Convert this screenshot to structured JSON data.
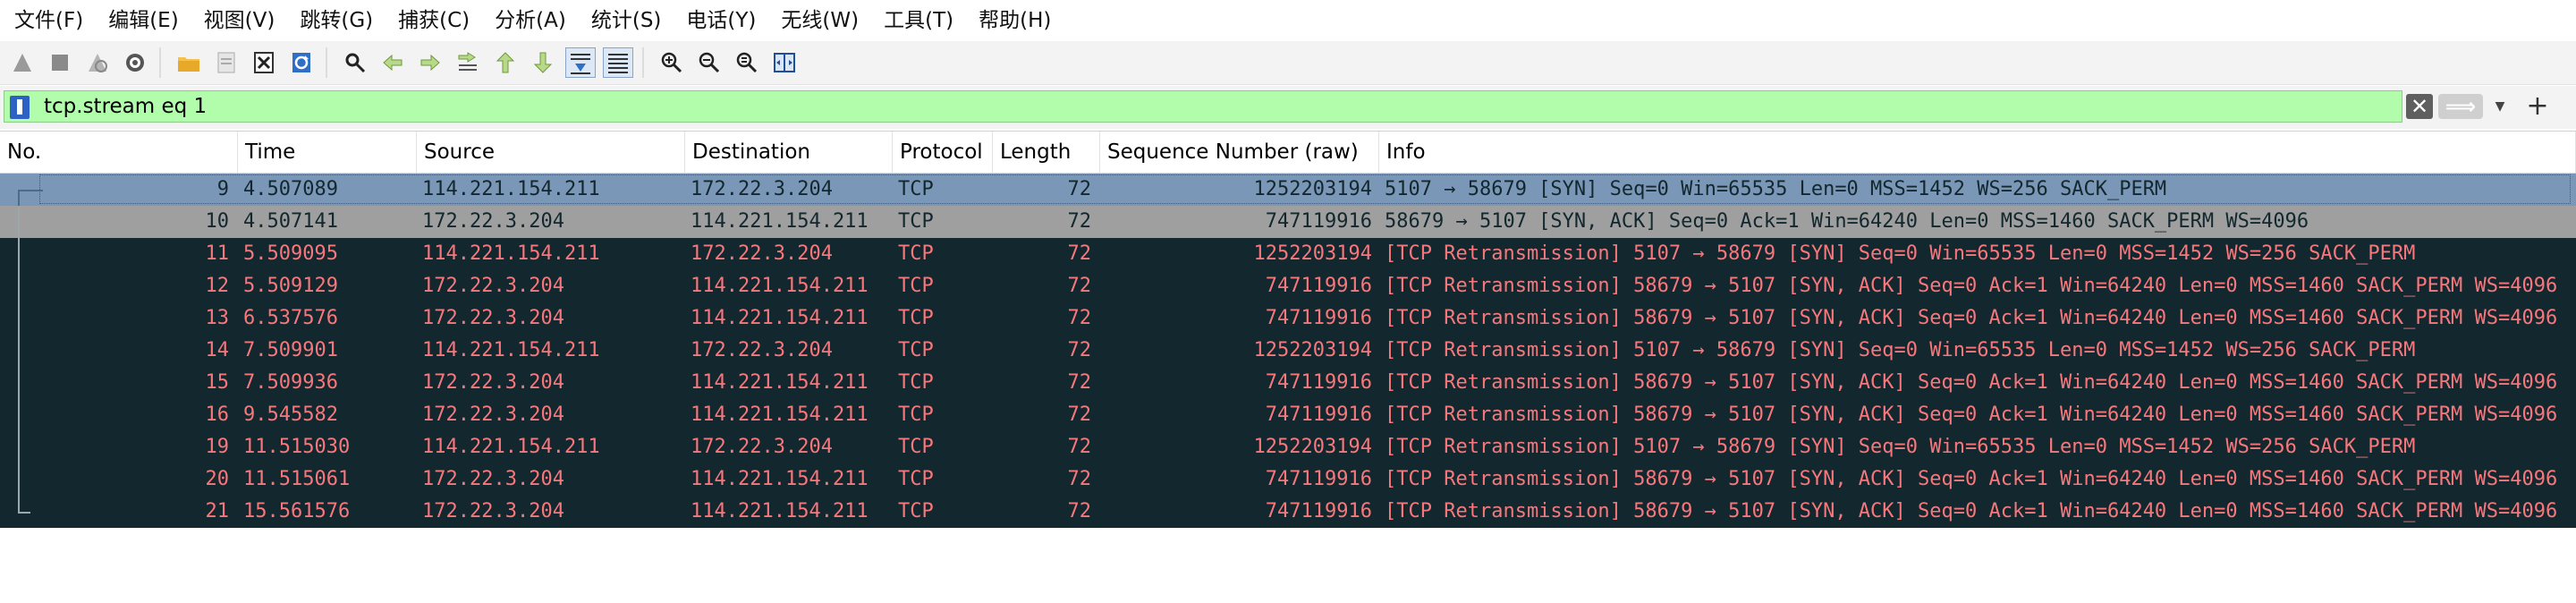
{
  "menu": [
    "文件(F)",
    "编辑(E)",
    "视图(V)",
    "跳转(G)",
    "捕获(C)",
    "分析(A)",
    "统计(S)",
    "电话(Y)",
    "无线(W)",
    "工具(T)",
    "帮助(H)"
  ],
  "toolbar": {
    "buttons": [
      "start-capture",
      "stop-capture",
      "restart-capture",
      "capture-options",
      "open-file",
      "save-file",
      "close-file",
      "reload-file",
      "find-packet",
      "go-back",
      "go-forward",
      "go-to-packet",
      "go-first",
      "go-last",
      "autoscroll",
      "colorize",
      "zoom-in",
      "zoom-out",
      "zoom-normal",
      "resize-columns"
    ]
  },
  "filter": {
    "text": "tcp.stream eq 1",
    "clear_glyph": "✕",
    "apply_glyph": "⟹",
    "dropdown_glyph": "▼",
    "add_glyph": "+"
  },
  "columns": [
    "No.",
    "Time",
    "Source",
    "Destination",
    "Protocol",
    "Length",
    "Sequence Number (raw)",
    "Info"
  ],
  "colors": {
    "selected_bg": "#7b97b8",
    "normal_bg": "#9f9f9f",
    "retrans_bg": "#12272e",
    "retrans_fg": "#f7787c",
    "normal_fg": "#12272e",
    "filter_bg": "#b1fdac"
  },
  "packets": [
    {
      "no": "9",
      "time": "4.507089",
      "src": "114.221.154.211",
      "dst": "172.22.3.204",
      "proto": "TCP",
      "len": "72",
      "seq": "1252203194",
      "info": "5107 → 58679 [SYN] Seq=0 Win=65535 Len=0 MSS=1452 WS=256 SACK_PERM",
      "style": "selected"
    },
    {
      "no": "10",
      "time": "4.507141",
      "src": "172.22.3.204",
      "dst": "114.221.154.211",
      "proto": "TCP",
      "len": "72",
      "seq": "747119916",
      "info": "58679 → 5107 [SYN, ACK] Seq=0 Ack=1 Win=64240 Len=0 MSS=1460 SACK_PERM WS=4096",
      "style": "normal"
    },
    {
      "no": "11",
      "time": "5.509095",
      "src": "114.221.154.211",
      "dst": "172.22.3.204",
      "proto": "TCP",
      "len": "72",
      "seq": "1252203194",
      "info": "[TCP Retransmission] 5107 → 58679 [SYN] Seq=0 Win=65535 Len=0 MSS=1452 WS=256 SACK_PERM",
      "style": "retrans"
    },
    {
      "no": "12",
      "time": "5.509129",
      "src": "172.22.3.204",
      "dst": "114.221.154.211",
      "proto": "TCP",
      "len": "72",
      "seq": "747119916",
      "info": "[TCP Retransmission] 58679 → 5107 [SYN, ACK] Seq=0 Ack=1 Win=64240 Len=0 MSS=1460 SACK_PERM WS=4096",
      "style": "retrans"
    },
    {
      "no": "13",
      "time": "6.537576",
      "src": "172.22.3.204",
      "dst": "114.221.154.211",
      "proto": "TCP",
      "len": "72",
      "seq": "747119916",
      "info": "[TCP Retransmission] 58679 → 5107 [SYN, ACK] Seq=0 Ack=1 Win=64240 Len=0 MSS=1460 SACK_PERM WS=4096",
      "style": "retrans"
    },
    {
      "no": "14",
      "time": "7.509901",
      "src": "114.221.154.211",
      "dst": "172.22.3.204",
      "proto": "TCP",
      "len": "72",
      "seq": "1252203194",
      "info": "[TCP Retransmission] 5107 → 58679 [SYN] Seq=0 Win=65535 Len=0 MSS=1452 WS=256 SACK_PERM",
      "style": "retrans"
    },
    {
      "no": "15",
      "time": "7.509936",
      "src": "172.22.3.204",
      "dst": "114.221.154.211",
      "proto": "TCP",
      "len": "72",
      "seq": "747119916",
      "info": "[TCP Retransmission] 58679 → 5107 [SYN, ACK] Seq=0 Ack=1 Win=64240 Len=0 MSS=1460 SACK_PERM WS=4096",
      "style": "retrans"
    },
    {
      "no": "16",
      "time": "9.545582",
      "src": "172.22.3.204",
      "dst": "114.221.154.211",
      "proto": "TCP",
      "len": "72",
      "seq": "747119916",
      "info": "[TCP Retransmission] 58679 → 5107 [SYN, ACK] Seq=0 Ack=1 Win=64240 Len=0 MSS=1460 SACK_PERM WS=4096",
      "style": "retrans"
    },
    {
      "no": "19",
      "time": "11.515030",
      "src": "114.221.154.211",
      "dst": "172.22.3.204",
      "proto": "TCP",
      "len": "72",
      "seq": "1252203194",
      "info": "[TCP Retransmission] 5107 → 58679 [SYN] Seq=0 Win=65535 Len=0 MSS=1452 WS=256 SACK_PERM",
      "style": "retrans"
    },
    {
      "no": "20",
      "time": "11.515061",
      "src": "172.22.3.204",
      "dst": "114.221.154.211",
      "proto": "TCP",
      "len": "72",
      "seq": "747119916",
      "info": "[TCP Retransmission] 58679 → 5107 [SYN, ACK] Seq=0 Ack=1 Win=64240 Len=0 MSS=1460 SACK_PERM WS=4096",
      "style": "retrans"
    },
    {
      "no": "21",
      "time": "15.561576",
      "src": "172.22.3.204",
      "dst": "114.221.154.211",
      "proto": "TCP",
      "len": "72",
      "seq": "747119916",
      "info": "[TCP Retransmission] 58679 → 5107 [SYN, ACK] Seq=0 Ack=1 Win=64240 Len=0 MSS=1460 SACK_PERM WS=4096",
      "style": "retrans"
    }
  ]
}
